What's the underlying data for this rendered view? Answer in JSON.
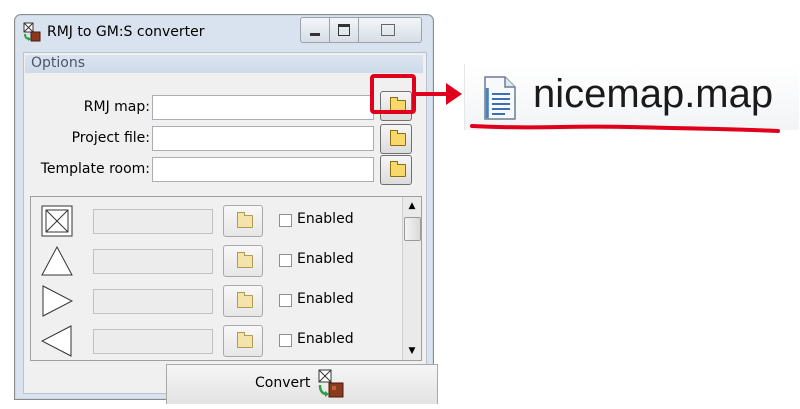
{
  "window": {
    "title": "RMJ to GM:S converter",
    "controls": [
      "minimize-icon",
      "maximize-icon",
      "close-icon"
    ]
  },
  "options": {
    "group_title": "Options",
    "rmj_map_label": "RMJ map:",
    "rmj_map_value": "",
    "project_file_label": "Project file:",
    "project_file_value": "",
    "template_room_label": "Template room:",
    "template_room_value": ""
  },
  "rules": [
    {
      "icon": "crossed-square-icon",
      "value": "",
      "enabled_label": "Enabled",
      "enabled": false
    },
    {
      "icon": "triangle-up-icon",
      "value": "",
      "enabled_label": "Enabled",
      "enabled": false
    },
    {
      "icon": "triangle-right-icon",
      "value": "",
      "enabled_label": "Enabled",
      "enabled": false
    },
    {
      "icon": "triangle-left-icon",
      "value": "",
      "enabled_label": "Enabled",
      "enabled": false
    }
  ],
  "convert": {
    "label": "Convert"
  },
  "annotation": {
    "file_name": "nicemap.map",
    "highlight_color": "#e0001b"
  },
  "colors": {
    "window_frame": "#d9e3ef",
    "client_bg": "#f0f0f0",
    "folder": "#f6d86b",
    "accent_red": "#e0001b"
  }
}
